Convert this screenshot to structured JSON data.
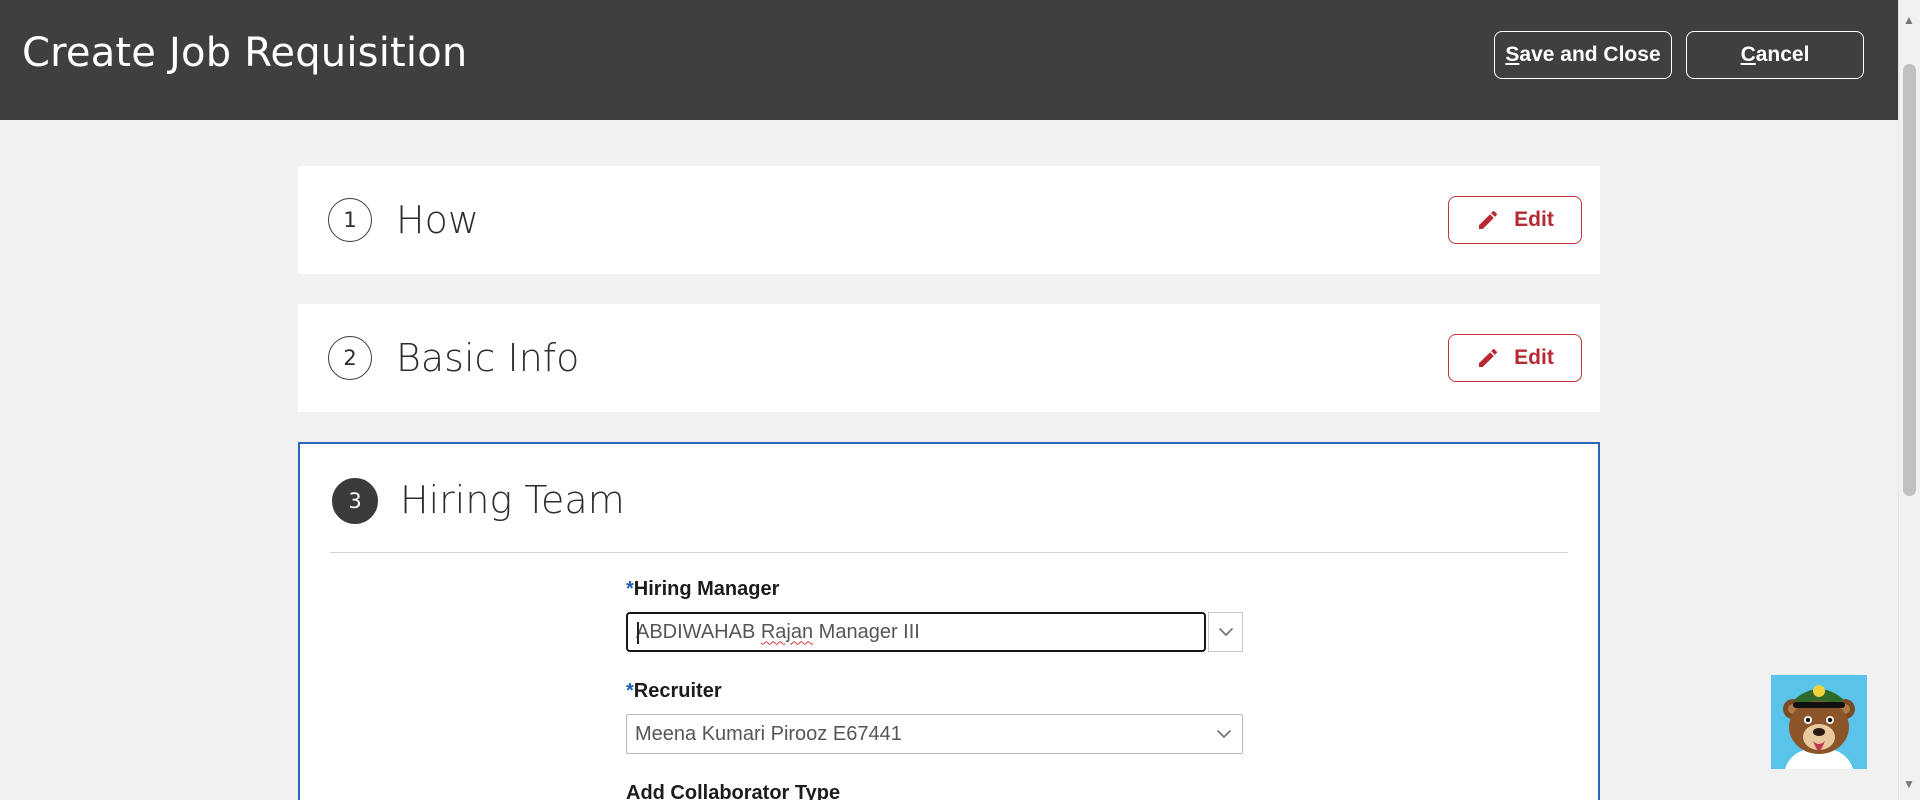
{
  "header": {
    "title": "Create Job Requisition",
    "save_close_label_first": "S",
    "save_close_label_rest": "ave and Close",
    "cancel_label_first": "C",
    "cancel_label_rest": "ancel"
  },
  "steps": [
    {
      "number": "1",
      "title": "How",
      "edit_label": "Edit"
    },
    {
      "number": "2",
      "title": "Basic Info",
      "edit_label": "Edit"
    },
    {
      "number": "3",
      "title": "Hiring Team"
    }
  ],
  "hiring_team": {
    "hiring_manager_label": "Hiring Manager",
    "required_mark": "*",
    "hiring_manager_value_a": "ABDIWAHAB ",
    "hiring_manager_value_b": "Rajan",
    "hiring_manager_value_c": " Manager III",
    "recruiter_label": "Recruiter",
    "recruiter_value": "Meena Kumari Pirooz E67441",
    "collaborator_label": "Add Collaborator Type"
  },
  "colors": {
    "header_bg": "#3f3f3f",
    "edit_accent": "#b52a33",
    "active_border": "#2c66bb",
    "required_star": "#1b5fb1"
  },
  "icons": [
    "pencil-icon",
    "chevron-down-icon",
    "bear-mascot-icon"
  ]
}
